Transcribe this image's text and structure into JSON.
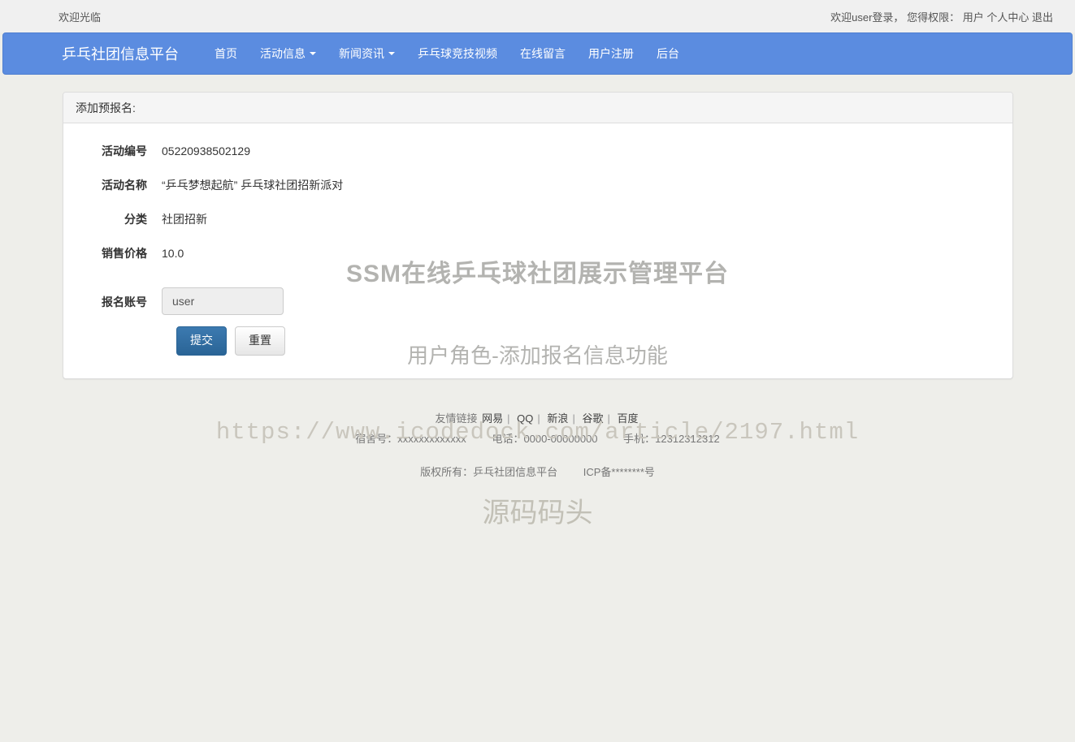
{
  "topbar": {
    "welcome": "欢迎光临",
    "login_prefix": "欢迎user登录，",
    "role_prefix": "您得权限：",
    "role": "用户",
    "profile_link": "个人中心",
    "logout_link": "退出"
  },
  "navbar": {
    "brand": "乒乓社团信息平台",
    "background_color": "#5b8ce0",
    "items": [
      {
        "label": "首页",
        "has_caret": false
      },
      {
        "label": "活动信息",
        "has_caret": true
      },
      {
        "label": "新闻资讯",
        "has_caret": true
      },
      {
        "label": "乒乓球竞技视频",
        "has_caret": false
      },
      {
        "label": "在线留言",
        "has_caret": false
      },
      {
        "label": "用户注册",
        "has_caret": false
      },
      {
        "label": "后台",
        "has_caret": false
      }
    ]
  },
  "panel": {
    "heading": "添加预报名:",
    "fields": [
      {
        "label": "活动编号",
        "value": "05220938502129"
      },
      {
        "label": "活动名称",
        "value": "“乒乓梦想起航” 乒乓球社团招新派对"
      },
      {
        "label": "分类",
        "value": "社团招新"
      },
      {
        "label": "销售价格",
        "value": "10.0"
      }
    ],
    "account": {
      "label": "报名账号",
      "value": "user",
      "placeholder": "报名账号"
    },
    "buttons": {
      "submit": "提交",
      "reset": "重置"
    }
  },
  "footer": {
    "friendly_label": "友情链接",
    "links": [
      "网易",
      "QQ",
      "新浪",
      "谷歌",
      "百度"
    ],
    "separator": "|",
    "contact": {
      "dorm": "宿舍号：xxxxxxxxxxxxx",
      "tel": "电话：0000-00000000",
      "mobile": "手机：12312312312"
    },
    "copyright": "版权所有：乒乓社团信息平台",
    "icp": "ICP备********号"
  },
  "watermarks": {
    "title": "SSM在线乒乓球社团展示管理平台",
    "subtitle": "用户角色-添加报名信息功能",
    "url": "https://www.icodedock.com/article/2197.html",
    "source": "源码码头"
  }
}
